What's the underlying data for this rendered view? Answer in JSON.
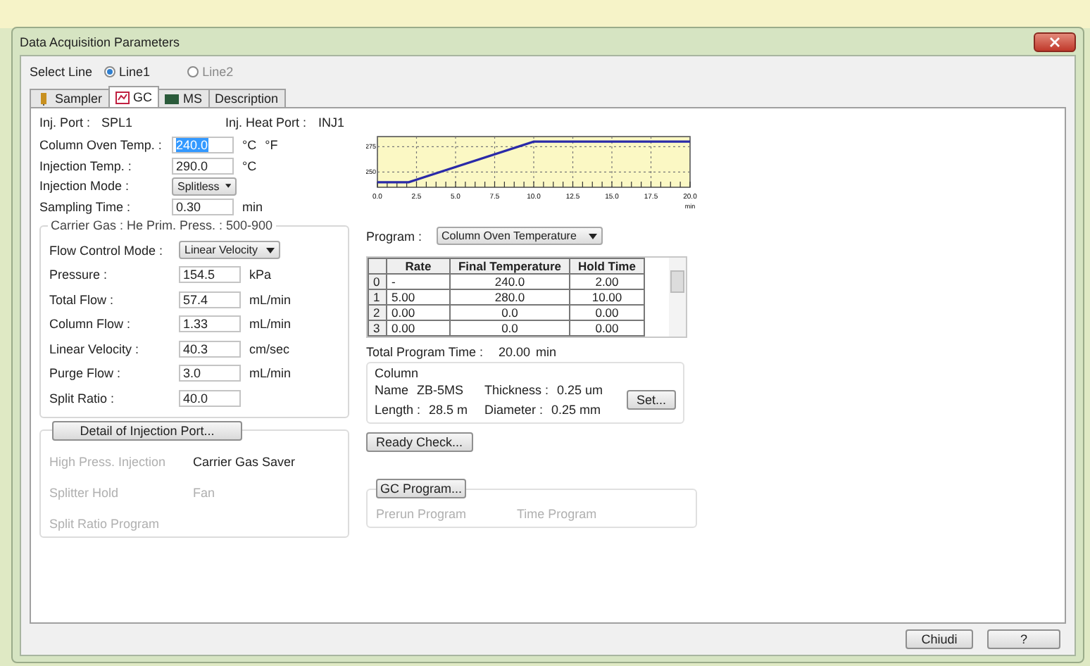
{
  "window": {
    "title": "Data Acquisition Parameters"
  },
  "select_line": {
    "label": "Select Line",
    "options": [
      {
        "label": "Line1",
        "selected": true
      },
      {
        "label": "Line2",
        "selected": false
      }
    ]
  },
  "tabs": [
    {
      "label": "Sampler",
      "kind": "sampler",
      "selected": false
    },
    {
      "label": "GC",
      "kind": "gc",
      "selected": true
    },
    {
      "label": "MS",
      "kind": "ms",
      "selected": false
    },
    {
      "label": "Description",
      "kind": "description",
      "selected": false
    }
  ],
  "inj_port": {
    "label": "Inj. Port :",
    "value": "SPL1",
    "heat_label": "Inj. Heat Port :",
    "heat_value": "INJ1"
  },
  "fields": [
    {
      "label": "Column Oven Temp. :",
      "kind": "input",
      "value": "240.0",
      "selected": true,
      "unit": "°C",
      "unit2": "°F"
    },
    {
      "label": "Injection Temp. :",
      "kind": "input",
      "value": "290.0",
      "selected": false,
      "unit": "°C"
    },
    {
      "label": "Injection Mode :",
      "kind": "dropdown",
      "value": "Splitless"
    },
    {
      "label": "Sampling Time :",
      "kind": "input",
      "value": "0.30",
      "selected": false,
      "unit": "min"
    }
  ],
  "carrier": {
    "legend": "Carrier Gas : He   Prim. Press. : 500-900",
    "fields": [
      {
        "label": "Flow Control Mode :",
        "kind": "dropdown",
        "value": "Linear Velocity"
      },
      {
        "label": "Pressure :",
        "kind": "input",
        "value": "154.5",
        "unit": "kPa"
      },
      {
        "label": "Total Flow :",
        "kind": "input",
        "value": "57.4",
        "unit": "mL/min"
      },
      {
        "label": "Column Flow :",
        "kind": "input",
        "value": "1.33",
        "unit": "mL/min"
      },
      {
        "label": "Linear Velocity :",
        "kind": "input",
        "value": "40.3",
        "unit": "cm/sec"
      },
      {
        "label": "Purge Flow :",
        "kind": "input",
        "value": "3.0",
        "unit": "mL/min"
      },
      {
        "label": "Split Ratio :",
        "kind": "input",
        "value": "40.0"
      }
    ]
  },
  "injection_detail": {
    "button": "Detail of Injection Port...",
    "items": [
      {
        "label": "High Press. Injection",
        "disabled": true
      },
      {
        "label": "Carrier Gas Saver",
        "disabled": false
      },
      {
        "label": "Splitter Hold",
        "disabled": true
      },
      {
        "label": "Fan",
        "disabled": true
      },
      {
        "label": "Split Ratio Program",
        "disabled": true
      }
    ]
  },
  "chart_data": {
    "type": "line",
    "x": [
      0,
      2,
      10,
      20
    ],
    "grid": true,
    "series": [
      {
        "color": "#2a2aa8",
        "values": [
          240,
          240,
          280,
          280
        ]
      }
    ],
    "xlabel": "min",
    "xlim": [
      0,
      20
    ],
    "ylim": [
      235,
      285
    ],
    "xticks": [
      {
        "value": 0,
        "label": "0.0"
      },
      {
        "value": 2.5,
        "label": "2.5"
      },
      {
        "value": 5,
        "label": "5.0"
      },
      {
        "value": 7.5,
        "label": "7.5"
      },
      {
        "value": 10,
        "label": "10.0"
      },
      {
        "value": 12.5,
        "label": "12.5"
      },
      {
        "value": 15,
        "label": "15.0"
      },
      {
        "value": 17.5,
        "label": "17.5"
      },
      {
        "value": 20,
        "label": "20.0"
      }
    ],
    "yticks": [
      250,
      275
    ]
  },
  "program": {
    "label": "Program :",
    "value": "Column Oven Temperature"
  },
  "table": {
    "columns": [
      "Rate",
      "Final Temperature",
      "Hold Time"
    ],
    "rows": [
      {
        "index": "0",
        "cells": [
          "-",
          "240.0",
          "2.00"
        ]
      },
      {
        "index": "1",
        "cells": [
          "5.00",
          "280.0",
          "10.00"
        ]
      },
      {
        "index": "2",
        "cells": [
          "0.00",
          "0.0",
          "0.00"
        ]
      },
      {
        "index": "3",
        "cells": [
          "0.00",
          "0.0",
          "0.00"
        ]
      }
    ]
  },
  "total_time": {
    "label": "Total Program Time :",
    "value": "20.00",
    "unit": "min"
  },
  "column": {
    "legend": "Column",
    "name_label": "Name",
    "name": "ZB-5MS",
    "length_label": "Length :",
    "length": "28.5 m",
    "thickness_label": "Thickness :",
    "thickness": "0.25 um",
    "diameter_label": "Diameter :",
    "diameter": "0.25 mm",
    "button": "Set..."
  },
  "ready_button": "Ready Check...",
  "gc_program": {
    "button": "GC Program...",
    "items": [
      {
        "label": "Prerun Program",
        "disabled": true
      },
      {
        "label": "Time Program",
        "disabled": true
      }
    ]
  },
  "footer_buttons": [
    "Chiudi",
    "?"
  ]
}
